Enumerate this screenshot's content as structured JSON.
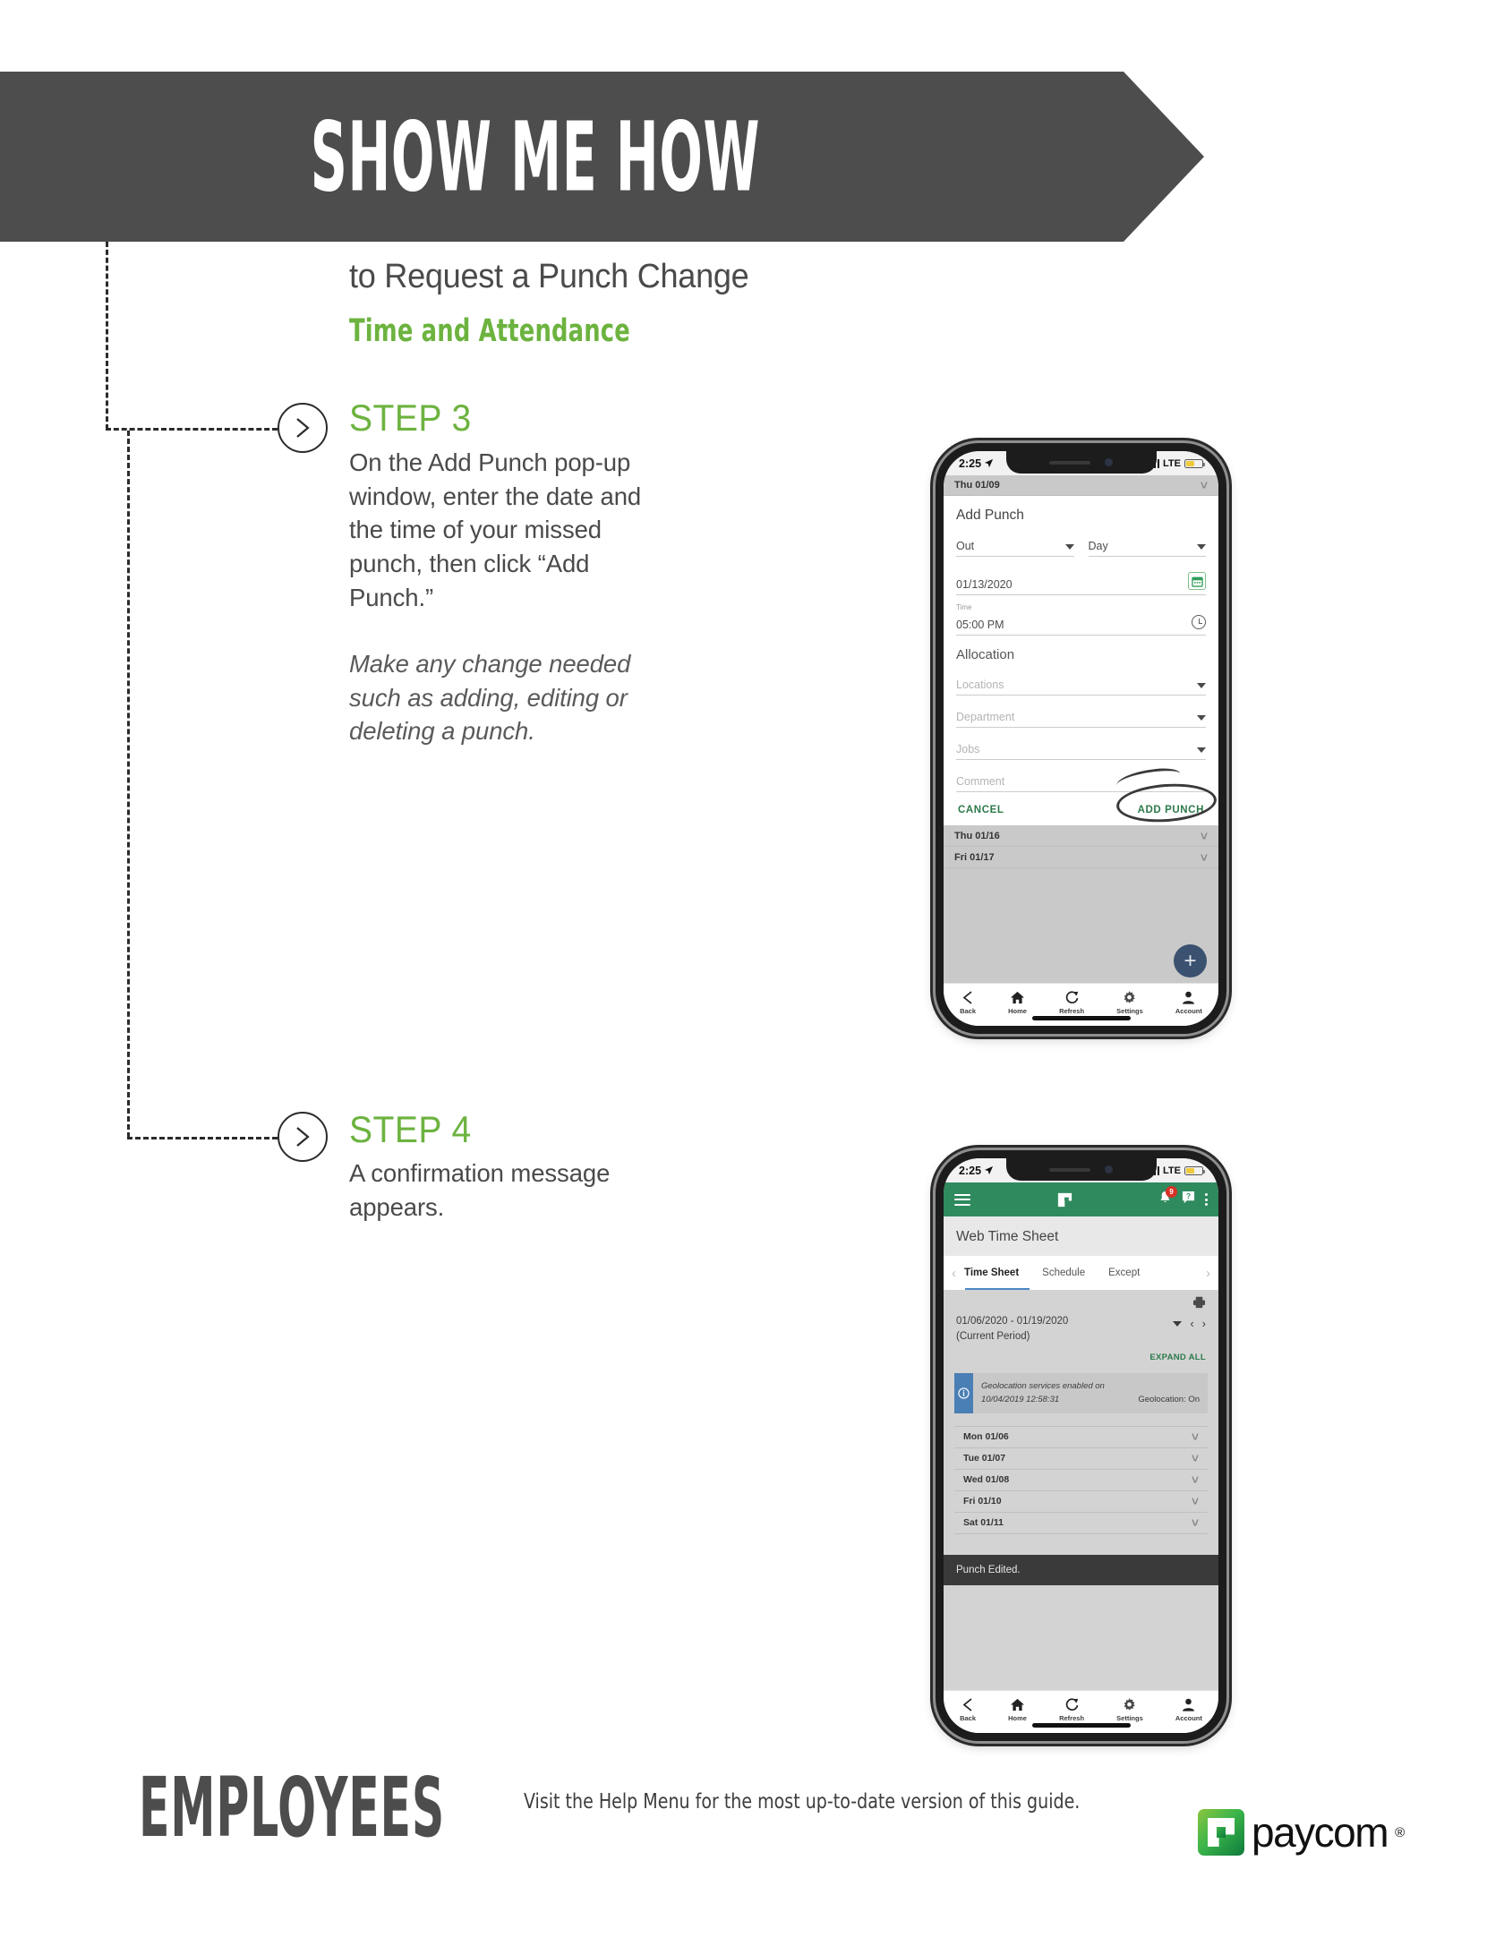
{
  "header": {
    "banner_title": "SHOW ME HOW",
    "subtitle": "to Request a Punch Change",
    "category": "Time and Attendance"
  },
  "colors": {
    "brand_green": "#6cb33f",
    "banner_gray": "#4d4d4d",
    "app_green": "#2f8a5e",
    "accent_blue": "#4c86c4",
    "toast_dark": "#3a3a3a"
  },
  "steps": [
    {
      "id": "step-3",
      "heading": "STEP 3",
      "body": "On the Add Punch pop-up window, enter the date and the time of your missed punch, then click “Add Punch.”",
      "note": "Make any change needed such as adding, editing or deleting a punch."
    },
    {
      "id": "step-4",
      "heading": "STEP 4",
      "body": "A confirmation message appears.",
      "note": ""
    }
  ],
  "phone1": {
    "status": {
      "time": "2:25",
      "carrier": "LTE"
    },
    "behind_top_row": "Thu 01/09",
    "dialog": {
      "title": "Add Punch",
      "punch_type": "Out",
      "shift": "Day",
      "date_value": "01/13/2020",
      "time_label": "Time",
      "time_value": "05:00 PM",
      "allocation_title": "Allocation",
      "locations_placeholder": "Locations",
      "department_placeholder": "Department",
      "jobs_placeholder": "Jobs",
      "comment_placeholder": "Comment",
      "cancel_label": "CANCEL",
      "add_label": "ADD PUNCH"
    },
    "behind_rows": [
      "Thu 01/16",
      "Fri 01/17"
    ],
    "fab_label": "+",
    "tabbar": [
      {
        "label": "Back",
        "icon": "chevron-left-icon"
      },
      {
        "label": "Home",
        "icon": "home-icon"
      },
      {
        "label": "Refresh",
        "icon": "refresh-icon"
      },
      {
        "label": "Settings",
        "icon": "gear-icon"
      },
      {
        "label": "Account",
        "icon": "person-icon"
      }
    ]
  },
  "phone2": {
    "status": {
      "time": "2:25",
      "carrier": "LTE"
    },
    "appbar": {
      "notification_count": "9"
    },
    "page_title": "Web Time Sheet",
    "tabs": [
      "Time Sheet",
      "Schedule",
      "Except"
    ],
    "active_tab": "Time Sheet",
    "period": "01/06/2020 - 01/19/2020",
    "period_note": "(Current Period)",
    "expand_all": "EXPAND ALL",
    "geolocation": {
      "message_line1": "Geolocation services enabled on",
      "message_line2": "10/04/2019 12:58:31",
      "status": "Geolocation: On"
    },
    "day_rows": [
      "Mon 01/06",
      "Tue 01/07",
      "Wed 01/08",
      "Fri 01/10",
      "Sat 01/11"
    ],
    "toast": "Punch Edited.",
    "tabbar": [
      {
        "label": "Back",
        "icon": "chevron-left-icon"
      },
      {
        "label": "Home",
        "icon": "home-icon"
      },
      {
        "label": "Refresh",
        "icon": "refresh-icon"
      },
      {
        "label": "Settings",
        "icon": "gear-icon"
      },
      {
        "label": "Account",
        "icon": "person-icon"
      }
    ]
  },
  "footer": {
    "audience": "EMPLOYEES",
    "note": "Visit the Help Menu for the most up-to-date version of this guide.",
    "brand": "paycom",
    "brand_mark": "®"
  }
}
